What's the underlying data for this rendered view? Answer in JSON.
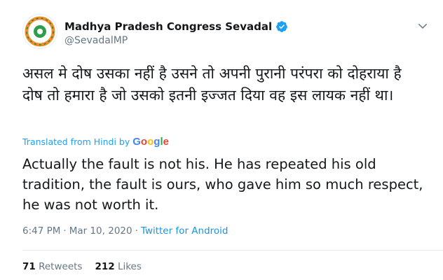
{
  "user": {
    "display_name": "Madhya Pradesh Congress Sevadal",
    "handle": "@SevadalMP"
  },
  "tweet": {
    "text_hindi": "असल मे दोष उसका नहीं है उसने तो अपनी पुरानी परंपरा को दोहराया है दोष तो हमारा है  जो उसको इतनी इज्जत दिया वह इस लायक नहीं था।",
    "translated_from": "Translated from Hindi by",
    "translator": "Google",
    "translation": "Actually the fault is not his. He has repeated his old tradition, the fault is ours, who gave him so much respect, he was not worth it."
  },
  "meta": {
    "time": "6:47 PM",
    "sep1": "·",
    "date": "Mar 10, 2020",
    "sep2": "·",
    "source": "Twitter for Android"
  },
  "stats": {
    "retweets_count": "71",
    "retweets_label": "Retweets",
    "likes_count": "212",
    "likes_label": "Likes"
  },
  "colors": {
    "link": "#1da1f2",
    "muted": "#657786",
    "text": "#14171a",
    "verified": "#1da1f2"
  },
  "icons": {
    "verified": "verified-badge-icon",
    "caret": "chevron-down-icon"
  }
}
